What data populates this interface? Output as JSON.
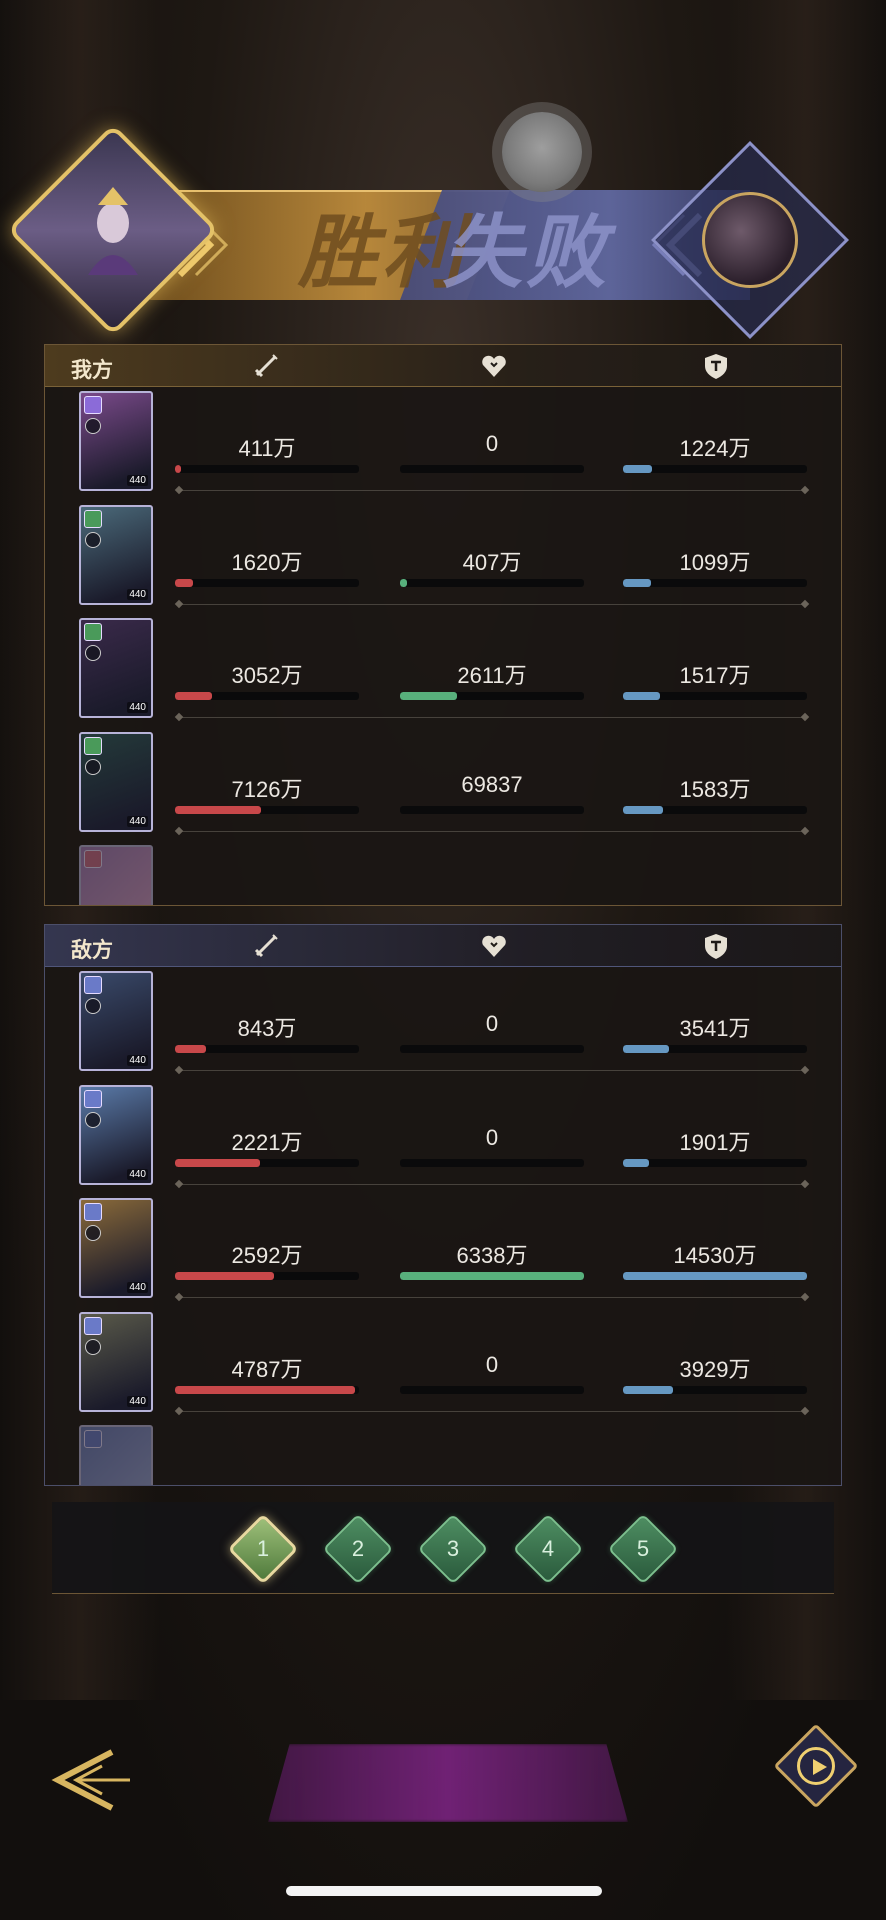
{
  "banner": {
    "victory": "胜利",
    "defeat": "失败"
  },
  "teams": {
    "ally": {
      "label": "我方",
      "rows": [
        {
          "damage": "411万",
          "heal": "0",
          "tank": "1224万",
          "dmg_ratio": 0.03,
          "heal_ratio": 0.0,
          "tank_ratio": 0.16,
          "card_color": "#7a4a8a",
          "badge": "#8b6bd8",
          "lvl": "440"
        },
        {
          "damage": "1620万",
          "heal": "407万",
          "tank": "1099万",
          "dmg_ratio": 0.1,
          "heal_ratio": 0.04,
          "tank_ratio": 0.15,
          "card_color": "#4b6a7a",
          "badge": "#4a9a5a",
          "lvl": "440"
        },
        {
          "damage": "3052万",
          "heal": "2611万",
          "tank": "1517万",
          "dmg_ratio": 0.2,
          "heal_ratio": 0.31,
          "tank_ratio": 0.2,
          "card_color": "#3a2a4a",
          "badge": "#4a9a5a",
          "lvl": "440"
        },
        {
          "damage": "7126万",
          "heal": "69837",
          "tank": "1583万",
          "dmg_ratio": 0.47,
          "heal_ratio": 0.0,
          "tank_ratio": 0.22,
          "card_color": "#243a3a",
          "badge": "#4a9a5a",
          "lvl": "440"
        }
      ]
    },
    "enemy": {
      "label": "敌方",
      "rows": [
        {
          "damage": "843万",
          "heal": "0",
          "tank": "3541万",
          "dmg_ratio": 0.17,
          "heal_ratio": 0.0,
          "tank_ratio": 0.25,
          "card_color": "#3a4a6a",
          "badge": "#6a7ac8",
          "lvl": "440"
        },
        {
          "damage": "2221万",
          "heal": "0",
          "tank": "1901万",
          "dmg_ratio": 0.46,
          "heal_ratio": 0.0,
          "tank_ratio": 0.14,
          "card_color": "#5a7aa8",
          "badge": "#6a7ac8",
          "lvl": "440"
        },
        {
          "damage": "2592万",
          "heal": "6338万",
          "tank": "14530万",
          "dmg_ratio": 0.54,
          "heal_ratio": 1.0,
          "tank_ratio": 1.0,
          "card_color": "#8a6a3a",
          "badge": "#6a7ac8",
          "lvl": "440"
        },
        {
          "damage": "4787万",
          "heal": "0",
          "tank": "3929万",
          "dmg_ratio": 0.98,
          "heal_ratio": 0.0,
          "tank_ratio": 0.27,
          "card_color": "#5a5a4a",
          "badge": "#6a7ac8",
          "lvl": "440"
        }
      ]
    }
  },
  "pager": {
    "pages": [
      "1",
      "2",
      "3",
      "4",
      "5"
    ],
    "active": 0
  },
  "icons": {
    "damage": "sword-icon",
    "heal": "heart-icon",
    "tank": "shield-icon",
    "back": "back-arrow-icon",
    "replay": "replay-icon"
  },
  "colors": {
    "damage_bar": "#c8484a",
    "heal_bar": "#58b07c",
    "tank_bar": "#6698c2",
    "ally_accent": "#e4c268",
    "enemy_accent": "#8d92c8"
  }
}
